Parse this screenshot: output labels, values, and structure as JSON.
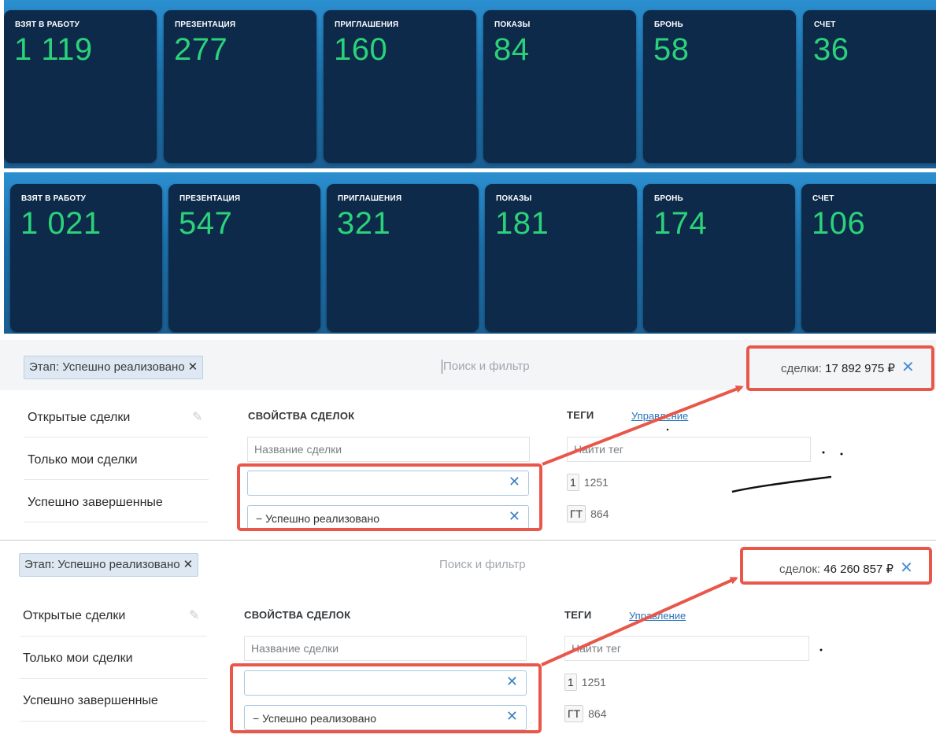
{
  "dashboard1": {
    "cards": [
      {
        "label": "ВЗЯТ В РАБОТУ",
        "value": "1 119"
      },
      {
        "label": "ПРЕЗЕНТАЦИЯ",
        "value": "277"
      },
      {
        "label": "ПРИГЛАШЕНИЯ",
        "value": "160"
      },
      {
        "label": "ПОКАЗЫ",
        "value": "84"
      },
      {
        "label": "БРОНЬ",
        "value": "58"
      },
      {
        "label": "СЧЕТ",
        "value": "36"
      }
    ]
  },
  "dashboard2": {
    "cards": [
      {
        "label": "ВЗЯТ В РАБОТУ",
        "value": "1 021"
      },
      {
        "label": "ПРЕЗЕНТАЦИЯ",
        "value": "547"
      },
      {
        "label": "ПРИГЛАШЕНИЯ",
        "value": "321"
      },
      {
        "label": "ПОКАЗЫ",
        "value": "181"
      },
      {
        "label": "БРОНЬ",
        "value": "174"
      },
      {
        "label": "СЧЕТ",
        "value": "106"
      }
    ]
  },
  "crm1": {
    "filter_chip": "Этап: Успешно реализовано",
    "search_placeholder": "Поиск и фильтр",
    "total_label": "сделки:",
    "total_value": "17 892 975 ₽",
    "menu": [
      "Открытые сделки",
      "Только мои сделки",
      "Успешно завершенные"
    ],
    "properties_title": "СВОЙСТВА СДЕЛОК",
    "deal_name_placeholder": "Название сделки",
    "stage_value": "Успешно реализовано",
    "tags_title": "ТЕГИ",
    "manage_link": "Управление",
    "tag_search_placeholder": "Найти тег",
    "tags": [
      {
        "tag": "1",
        "count": "1251"
      },
      {
        "tag": "ГТ",
        "count": "864"
      }
    ]
  },
  "crm2": {
    "filter_chip": "Этап: Успешно реализовано",
    "search_placeholder": "Поиск и фильтр",
    "total_label": "сделок:",
    "total_value": "46 260 857 ₽",
    "menu": [
      "Открытые сделки",
      "Только мои сделки",
      "Успешно завершенные"
    ],
    "properties_title": "СВОЙСТВА СДЕЛОК",
    "deal_name_placeholder": "Название сделки",
    "stage_value": "Успешно реализовано",
    "tags_title": "ТЕГИ",
    "manage_link": "Управление",
    "tag_search_placeholder": "Найти тег",
    "tags": [
      {
        "tag": "1",
        "count": "1251"
      },
      {
        "tag": "ГТ",
        "count": "864"
      }
    ]
  },
  "icons": {
    "close": "close-icon",
    "pencil": "pencil-icon",
    "minus": "minus-icon"
  },
  "colors": {
    "card_bg": "#0d2a4a",
    "value_green": "#2bd27a",
    "highlight_red": "#e8574a",
    "accent_blue": "#3d7fc1"
  }
}
